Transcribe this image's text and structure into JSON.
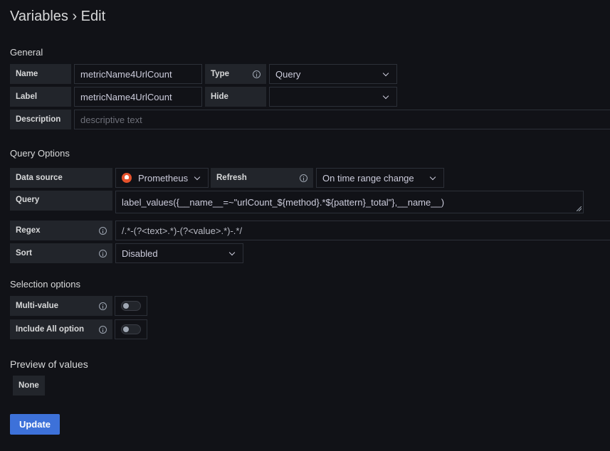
{
  "header": {
    "title": "Variables › Edit"
  },
  "general": {
    "section_title": "General",
    "name": {
      "label": "Name",
      "value": "metricName4UrlCount"
    },
    "type": {
      "label": "Type",
      "value": "Query"
    },
    "label": {
      "label": "Label",
      "value": "metricName4UrlCount"
    },
    "hide": {
      "label": "Hide",
      "value": ""
    },
    "description": {
      "label": "Description",
      "placeholder": "descriptive text"
    }
  },
  "query_options": {
    "section_title": "Query Options",
    "data_source": {
      "label": "Data source",
      "value": "Prometheus",
      "icon": "prometheus-icon"
    },
    "refresh": {
      "label": "Refresh",
      "value": "On time range change"
    },
    "query": {
      "label": "Query",
      "value": "label_values({__name__=~\"urlCount_${method}.*${pattern}_total\"},__name__)"
    },
    "regex": {
      "label": "Regex",
      "value": "/.*-(?<text>.*)-(?<value>.*)-.*/"
    },
    "sort": {
      "label": "Sort",
      "value": "Disabled"
    }
  },
  "selection_options": {
    "section_title": "Selection options",
    "multi_value": {
      "label": "Multi-value",
      "enabled": false
    },
    "include_all": {
      "label": "Include All option",
      "enabled": false
    }
  },
  "preview": {
    "section_title": "Preview of values",
    "values": [
      "None"
    ]
  },
  "actions": {
    "update_label": "Update"
  },
  "colors": {
    "background": "#111217",
    "label_bg": "#22252b",
    "primary": "#3d71d9",
    "prometheus": "#e6522c"
  }
}
